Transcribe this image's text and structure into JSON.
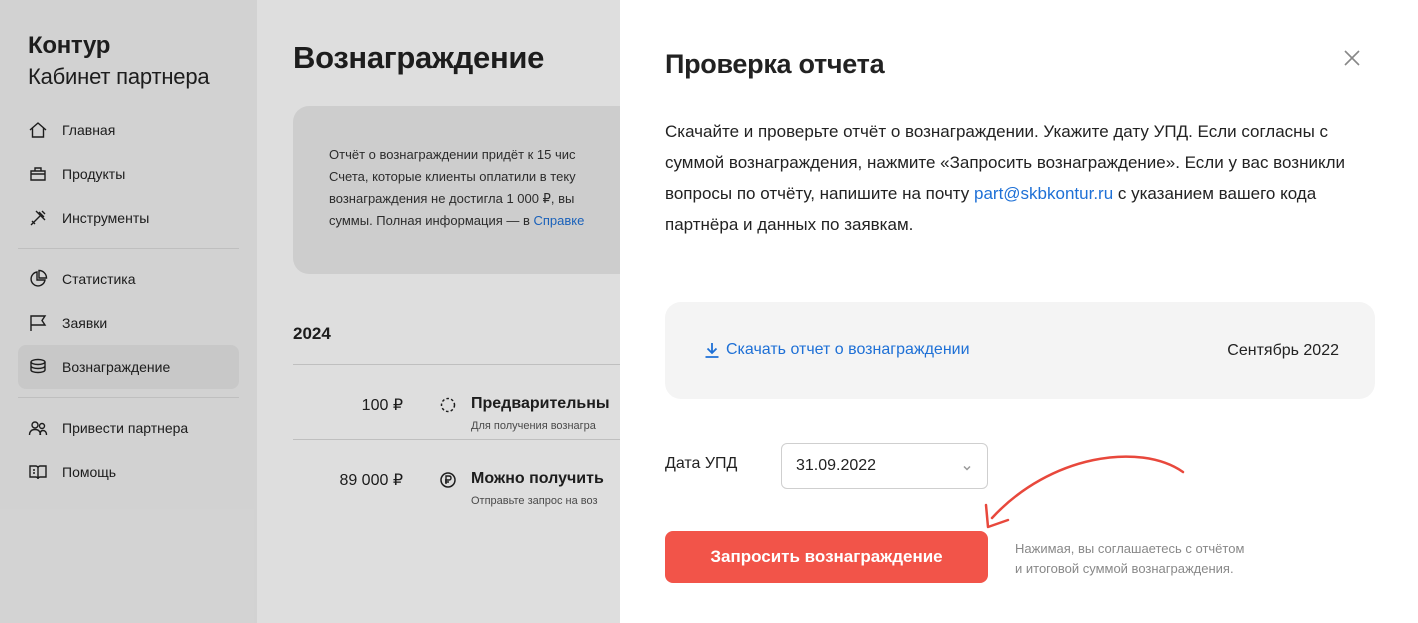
{
  "sidebar": {
    "brand": "Контур",
    "subtitle": "Кабинет партнера",
    "groups": [
      [
        {
          "label": "Главная",
          "icon": "home-icon"
        },
        {
          "label": "Продукты",
          "icon": "box-icon"
        },
        {
          "label": "Инструменты",
          "icon": "tools-icon"
        }
      ],
      [
        {
          "label": "Статистика",
          "icon": "pie-chart-icon"
        },
        {
          "label": "Заявки",
          "icon": "flag-icon"
        },
        {
          "label": "Вознаграждение",
          "icon": "coins-icon",
          "active": true
        }
      ],
      [
        {
          "label": "Привести партнера",
          "icon": "users-icon"
        },
        {
          "label": "Помощь",
          "icon": "help-book-icon"
        }
      ]
    ]
  },
  "main": {
    "title": "Вознаграждение",
    "info": {
      "line1": "Отчёт о вознаграждении придёт к 15 чис",
      "line2": "Счета, которые клиенты оплатили в теку",
      "line3": "вознаграждения не достигла 1 000 ₽, вы",
      "line4_prefix": "суммы. Полная информация — в ",
      "line4_link": "Справке"
    },
    "year": "2024",
    "rows": [
      {
        "amount": "100 ₽",
        "title": "Предварительны",
        "subtitle": "Для получения вознагра"
      },
      {
        "amount": "89 000 ₽",
        "title": "Можно получить",
        "subtitle": "Отправьте запрос на воз"
      }
    ]
  },
  "modal": {
    "title": "Проверка отчета",
    "description_before": "Скачайте и проверьте отчёт о вознаграждении. Укажите дату УПД. Если согласны с суммой вознаграждения, нажмите «Запросить вознаграждение». Если у вас возникли вопросы по отчёту, напишите на почту ",
    "email": "part@skbkontur.ru",
    "description_after": " с указанием вашего кода партнёра и данных по заявкам.",
    "download_label": "Скачать отчет о вознаграждении",
    "period": "Сентябрь 2022",
    "date_label": "Дата УПД",
    "date_value": "31.09.2022",
    "submit_label": "Запросить вознаграждение",
    "hint_line1": "Нажимая, вы соглашаетесь с отчётом",
    "hint_line2": "и итоговой суммой вознаграждения."
  },
  "colors": {
    "accent": "#f25449",
    "link": "#1e70d6",
    "annotation_arrow": "#e8483c"
  }
}
